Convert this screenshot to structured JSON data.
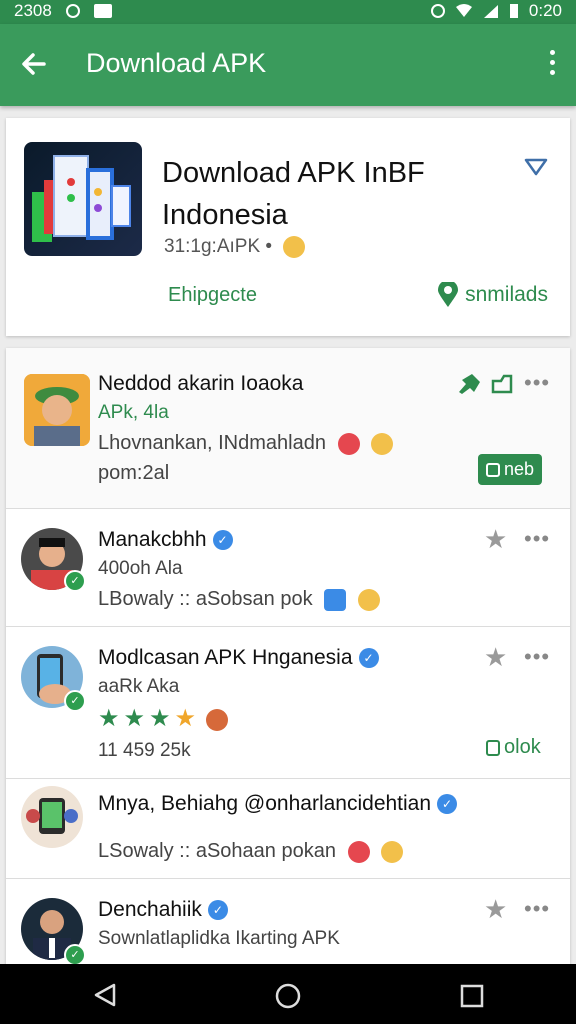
{
  "status": {
    "time_left": "2308",
    "time_right": "0:20"
  },
  "appbar": {
    "title": "Download APK",
    "back_icon": "back-arrow-icon",
    "more_icon": "more-vert-icon"
  },
  "header": {
    "title": "Download APK InBF Indonesia",
    "meta": "31:1g:AıPK •",
    "left_label": "Ehipgecte",
    "right_label": "snmilads"
  },
  "items": [
    {
      "name": "Neddod akarin Ioaoka",
      "line2": "APk, 4la",
      "line3": "Lhovnankan, INdmahladn",
      "line4": "pom:2al",
      "chip": "neb"
    },
    {
      "name": "Manakcbhh",
      "line2": "400oh Ala",
      "line3": "LBowaly :: aSobsan pok"
    },
    {
      "name": "Modlcasan APK Hnganesia",
      "line2": "aaRk Aka",
      "rating": 4,
      "line4": "11 459 25k",
      "chip": "olok"
    },
    {
      "name": "Mnya, Behiahg @onharlancidehtian",
      "line3": "LSowaly :: aSohaan pokan"
    },
    {
      "name": "Denchahiik",
      "line2": "Sownlatlaplidka Ikarting APK"
    }
  ],
  "colors": {
    "primary": "#3a9b5c",
    "status": "#2e8b4e",
    "accent": "#2e8b4e"
  }
}
